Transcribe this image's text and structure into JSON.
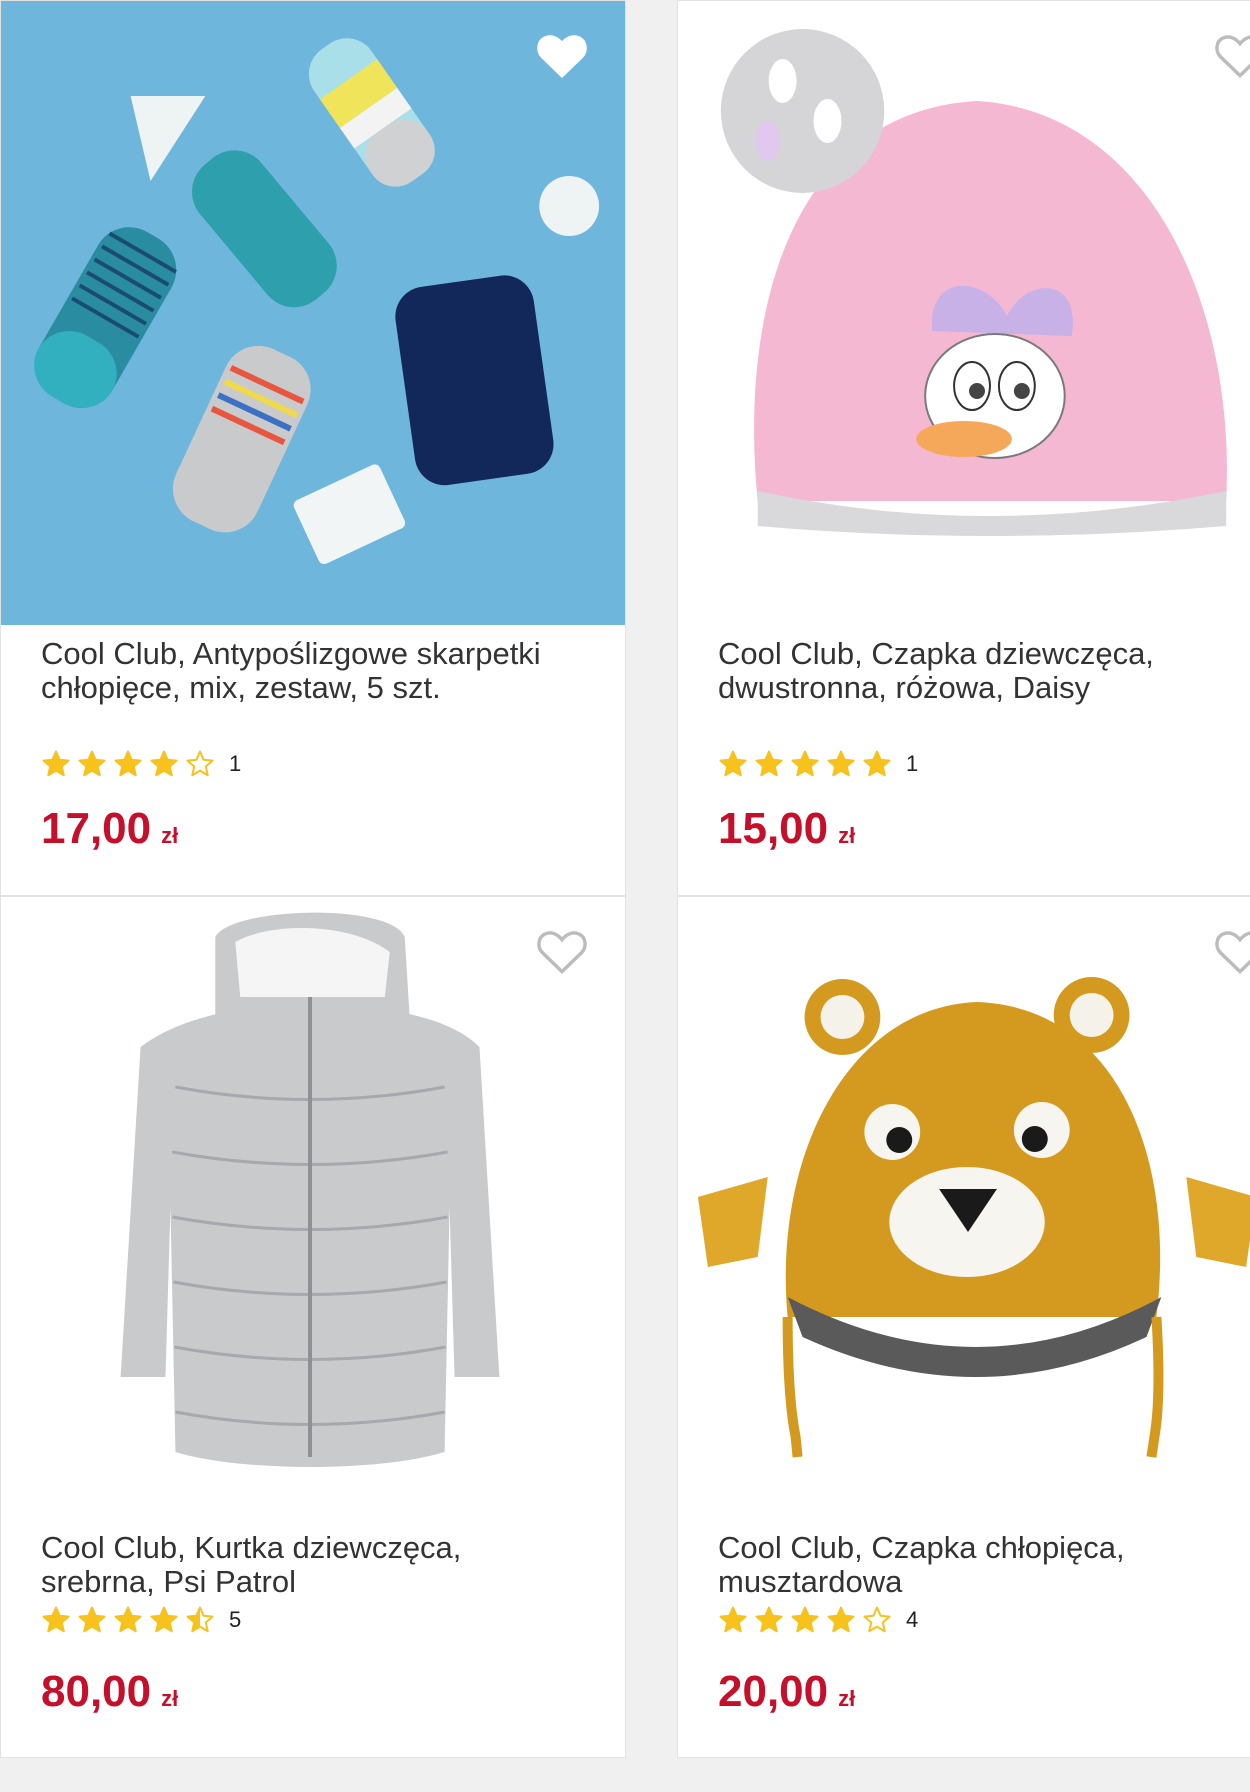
{
  "products": [
    {
      "title": "Cool Club, Antypoślizgowe skarpetki chłopięce, mix, zestaw, 5 szt.",
      "rating": 4,
      "reviews": "1",
      "price": "17,00",
      "currency": "zł"
    },
    {
      "title": "Cool Club, Czapka dziewczęca, dwustronna, różowa, Daisy",
      "rating": 5,
      "reviews": "1",
      "price": "15,00",
      "currency": "zł"
    },
    {
      "title": "Cool Club, Kurtka dziewczęca, srebrna, Psi Patrol",
      "rating": 4.5,
      "reviews": "5",
      "price": "80,00",
      "currency": "zł"
    },
    {
      "title": "Cool Club, Czapka chłopięca, musztardowa",
      "rating": 4,
      "reviews": "4",
      "price": "20,00",
      "currency": "zł"
    }
  ],
  "colors": {
    "price": "#c4102b",
    "star": "#f7c21b",
    "socks_bg": "#6fb6dc",
    "beanie_pink": "#f4b8d2",
    "jacket_silver": "#c9cacc",
    "hat_mustard": "#d39a1f"
  },
  "icons": {
    "wishlist": "heart-outline-icon",
    "rating": "star-icon"
  }
}
